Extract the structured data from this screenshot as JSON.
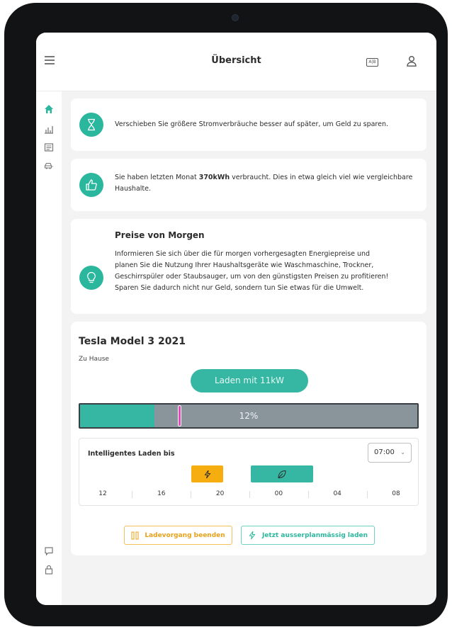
{
  "header": {
    "title": "Übersicht"
  },
  "tips": [
    {
      "icon": "hourglass-icon",
      "text": "Verschieben Sie größere Stromverbräuche besser auf später, um Geld zu sparen."
    },
    {
      "icon": "thumbs-up-icon",
      "text_prefix": "Sie haben letzten Monat ",
      "text_bold": "370kWh",
      "text_suffix": " verbraucht. Dies in etwa gleich viel wie vergleichbare Haushalte."
    },
    {
      "icon": "lightbulb-icon",
      "title": "Preise von Morgen",
      "text": "Informieren Sie sich über die für morgen vorhergesagten Energiepreise und planen Sie die Nutzung Ihrer Haushaltsgeräte wie Waschmaschine, Trockner, Geschirrspüler oder Staubsauger, um von den günstigsten Preisen zu profitieren! Sparen Sie dadurch nicht nur Geld, sondern tun Sie etwas für die Umwelt."
    }
  ],
  "vehicle": {
    "name": "Tesla Model 3 2021",
    "location": "Zu Hause",
    "charge_button": "Laden mit 11kW",
    "charge_percent_label": "12%",
    "charge_fill_fraction": 0.22,
    "target_marker_fraction": 0.29,
    "smart_charging": {
      "label": "Intelligentes Laden bis",
      "time_value": "07:00",
      "hour_ticks": [
        "12",
        "16",
        "20",
        "00",
        "04",
        "08"
      ]
    },
    "stop_button": "Ladevorgang beenden",
    "charge_now_button": "Jetzt ausserplanmässig laden"
  },
  "colors": {
    "accent": "#35b7a4",
    "orange": "#f6ad0f",
    "marker": "#e24bb9",
    "bar_gray": "#8a949b"
  }
}
